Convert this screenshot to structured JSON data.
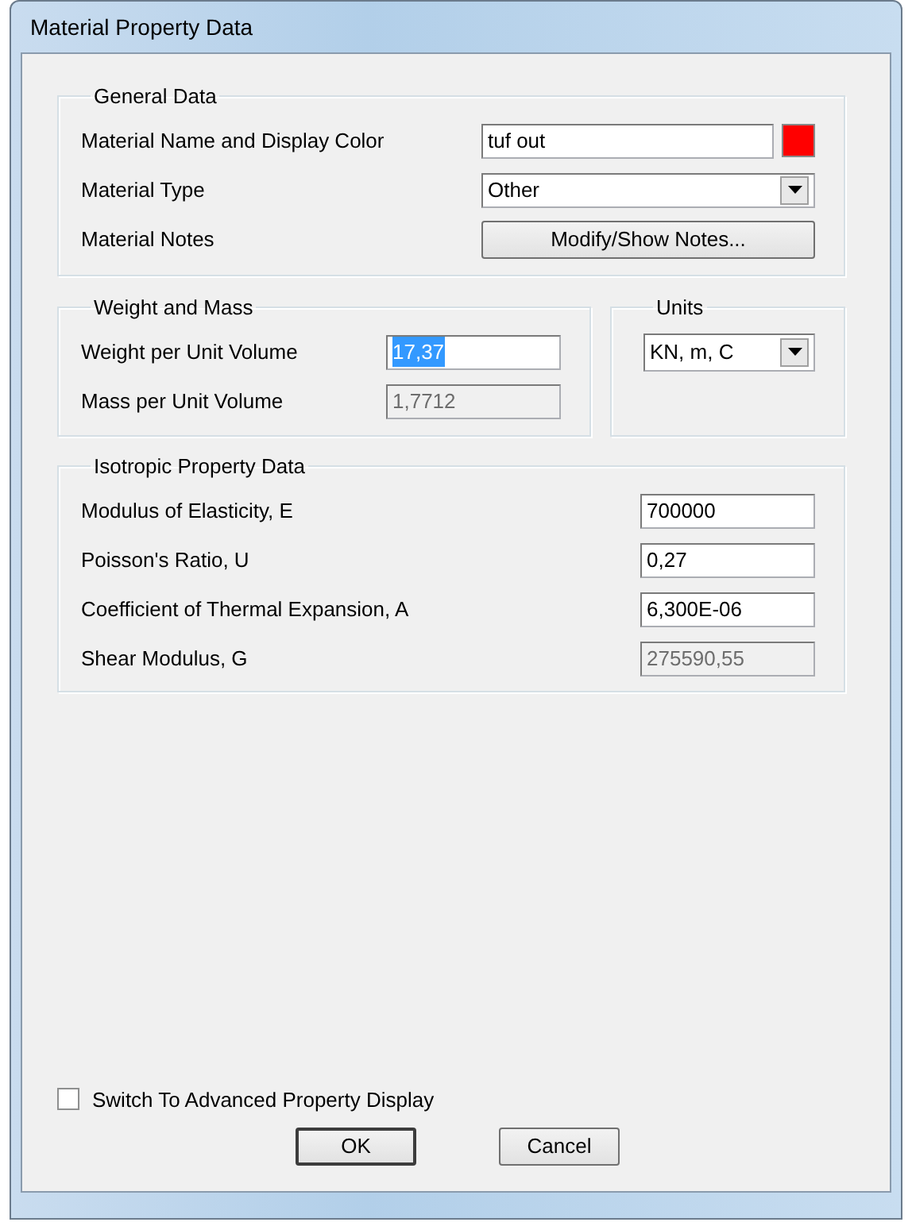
{
  "window": {
    "title": "Material Property Data"
  },
  "general_data": {
    "title": "General Data",
    "fields": [
      {
        "label": "Material Name and Display Color",
        "kind": "text",
        "value": "tuf out",
        "color": "#ff0000"
      },
      {
        "label": "Material Type",
        "kind": "select",
        "value": "Other"
      },
      {
        "label": "Material Notes",
        "kind": "button",
        "value": "Modify/Show Notes..."
      }
    ]
  },
  "weight_and_mass": {
    "title": "Weight and Mass",
    "fields": [
      {
        "label": "Weight per Unit Volume",
        "value": "17,37",
        "highlighted": true,
        "disabled": false
      },
      {
        "label": "Mass per Unit Volume",
        "value": "1,7712",
        "highlighted": false,
        "disabled": true
      }
    ]
  },
  "units": {
    "title": "Units",
    "value": "KN, m, C"
  },
  "isotropic_property_data": {
    "title": "Isotropic Property Data",
    "fields": [
      {
        "label": "Modulus of Elasticity,  E",
        "value": "700000",
        "disabled": false
      },
      {
        "label": "Poisson's Ratio,  U",
        "value": "0,27",
        "disabled": false
      },
      {
        "label": "Coefficient of Thermal Expansion,  A",
        "value": "6,300E-06",
        "disabled": false
      },
      {
        "label": "Shear Modulus,  G",
        "value": "275590,55",
        "disabled": true
      }
    ]
  },
  "advanced_display": {
    "label": "Switch To Advanced Property Display",
    "checked": false
  },
  "buttons": [
    {
      "label": "OK",
      "default": true
    },
    {
      "label": "Cancel",
      "default": false
    }
  ]
}
